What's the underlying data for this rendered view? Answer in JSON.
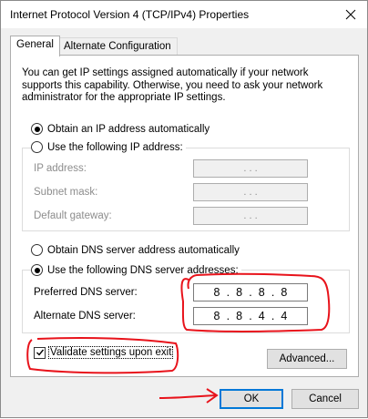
{
  "window": {
    "title": "Internet Protocol Version 4 (TCP/IPv4) Properties"
  },
  "tabs": [
    {
      "label": "General",
      "active": true
    },
    {
      "label": "Alternate Configuration",
      "active": false
    }
  ],
  "general": {
    "description": "You can get IP settings assigned automatically if your network supports this capability. Otherwise, you need to ask your network administrator for the appropriate IP settings.",
    "ip_auto_label": "Obtain an IP address automatically",
    "ip_manual_label": "Use the following IP address:",
    "ip_fields": [
      {
        "label": "IP address:",
        "value": ". . ."
      },
      {
        "label": "Subnet mask:",
        "value": ". . ."
      },
      {
        "label": "Default gateway:",
        "value": ". . ."
      }
    ],
    "dns_auto_label": "Obtain DNS server address automatically",
    "dns_manual_label": "Use the following DNS server addresses:",
    "dns_preferred": {
      "label": "Preferred DNS server:",
      "octets": [
        "8",
        "8",
        "8",
        "8"
      ]
    },
    "dns_alternate": {
      "label": "Alternate DNS server:",
      "octets": [
        "8",
        "8",
        "4",
        "4"
      ]
    },
    "validate_label": "Validate settings upon exit",
    "validate_checked": true,
    "advanced_label": "Advanced..."
  },
  "footer": {
    "ok_label": "OK",
    "cancel_label": "Cancel"
  },
  "annotation_color": "#e8131b",
  "accent_color": "#0078d7"
}
